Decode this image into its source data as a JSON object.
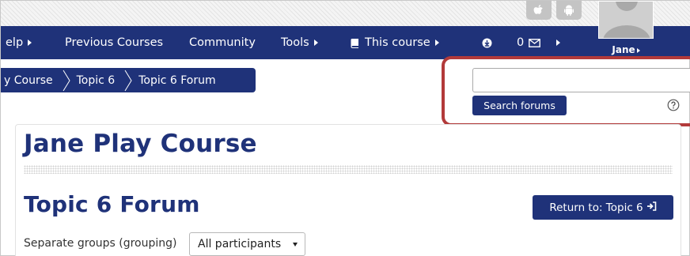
{
  "nav": {
    "help_label": "elp",
    "previous_courses_label": "Previous Courses",
    "community_label": "Community",
    "tools_label": "Tools",
    "this_course_label": "This course",
    "message_count": "0",
    "user_name": "Jane"
  },
  "breadcrumb": {
    "items": [
      "y Course",
      "Topic 6",
      "Topic 6 Forum"
    ]
  },
  "search": {
    "value": "",
    "button_label": "Search forums",
    "help_icon": "question-circle-icon"
  },
  "main": {
    "course_title": "Jane Play Course",
    "forum_title": "Topic 6 Forum",
    "return_button_label": "Return to: Topic 6",
    "group_label": "Separate groups (grouping)",
    "group_selected": "All participants"
  },
  "colors": {
    "brand": "#1f3279",
    "highlight": "#b23a3a"
  }
}
